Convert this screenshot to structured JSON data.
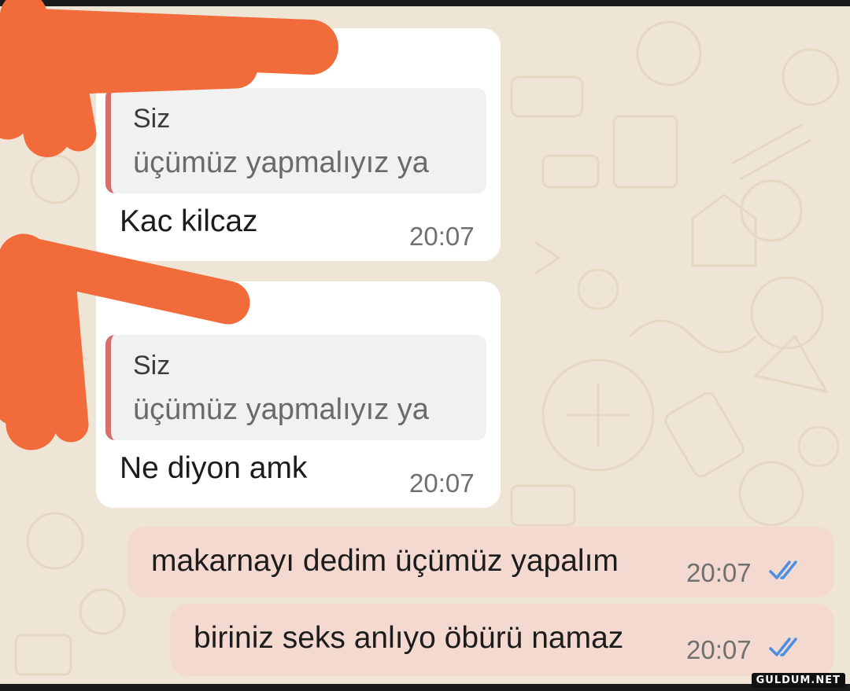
{
  "messages": [
    {
      "type": "incoming",
      "quote_author": "Siz",
      "quote_text": "üçümüz yapmalıyız ya",
      "text": "Kac kilcaz",
      "time": "20:07"
    },
    {
      "type": "incoming",
      "quote_author": "Siz",
      "quote_text": "üçümüz yapmalıyız ya",
      "text": "Ne diyon amk",
      "time": "20:07"
    },
    {
      "type": "outgoing",
      "text": "makarnayı dedim üçümüz yapalım",
      "time": "20:07",
      "status": "double-check-icon"
    },
    {
      "type": "outgoing",
      "text": "biriniz seks anlıyo öbürü namaz",
      "time": "20:07",
      "status": "double-check-icon"
    }
  ],
  "watermark": "GULDUM.NET",
  "colors": {
    "chat_background": "#efe5d6",
    "incoming_bubble": "#ffffff",
    "outgoing_bubble": "#f3d9cf",
    "quote_bar": "#d4706a",
    "read_tick": "#4a90e2",
    "redaction": "#f26b3a"
  }
}
